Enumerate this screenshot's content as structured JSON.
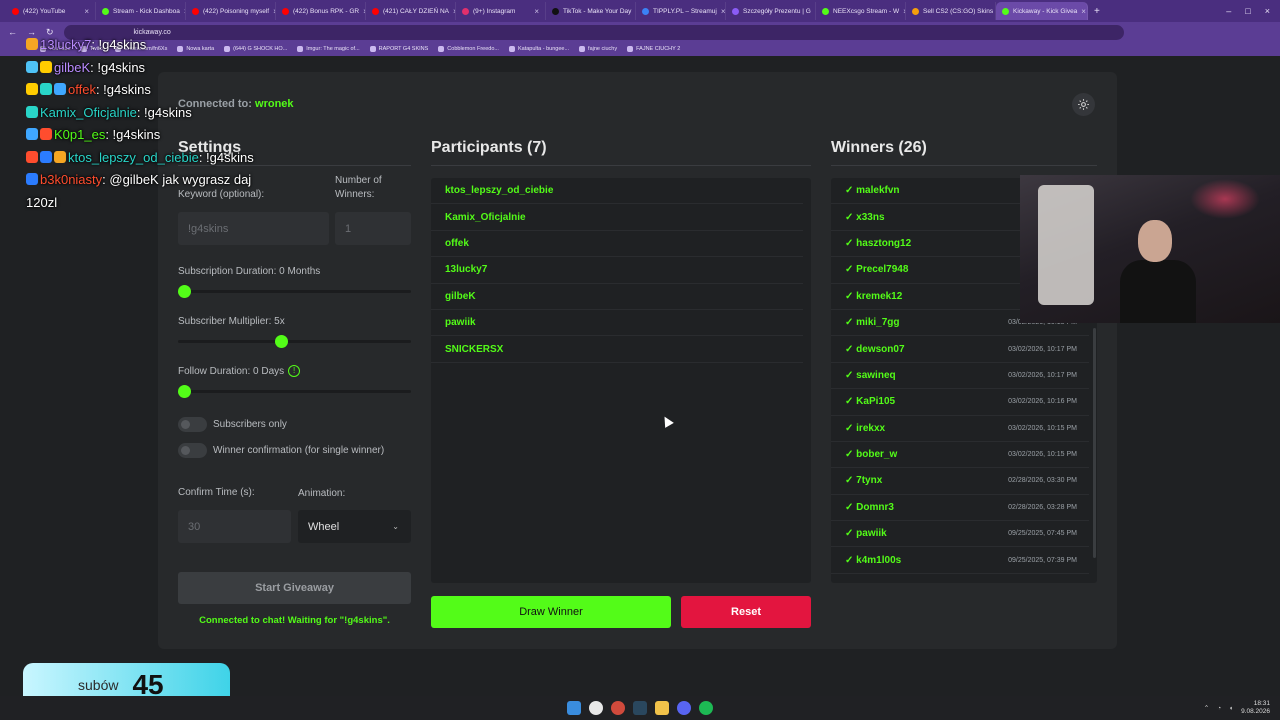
{
  "browser": {
    "tabs": [
      {
        "label": "(422) YouTube",
        "color": "#ff0000"
      },
      {
        "label": "Stream - Kick Dashboa",
        "color": "#53fc18"
      },
      {
        "label": "(422) Poisoning myself",
        "color": "#ff0000"
      },
      {
        "label": "(422) Bonus RPK - GR",
        "color": "#ff0000"
      },
      {
        "label": "(421) CAŁY DZIEŃ NA",
        "color": "#ff0000"
      },
      {
        "label": "(9+) Instagram",
        "color": "#e1306c"
      },
      {
        "label": "TikTok - Make Your Day",
        "color": "#111111"
      },
      {
        "label": "TIPPLY.PL – Streamuj",
        "color": "#3b82f6"
      },
      {
        "label": "Szczegóły Prezentu | G",
        "color": "#8b5cf6"
      },
      {
        "label": "NEEXcsgo Stream - W",
        "color": "#53fc18"
      },
      {
        "label": "Sell CS2 (CS:GO) Skins",
        "color": "#f59e0b"
      },
      {
        "label": "Kickaway - Kick Givea",
        "color": "#53fc18",
        "active": true
      }
    ],
    "url": "kickaway.co",
    "bookmarks": [
      "YouTube",
      "Twitch",
      "Enaza.com/fn6Xs",
      "Nowa karta",
      "(644) G SHOCK HO...",
      "Imgur: The magic of...",
      "RAPORT G4 SKINS",
      "Cobblemon Freedo...",
      "Katapulta - bungee...",
      "fajne ciuchy",
      "FAJNE CIUCHY 2"
    ]
  },
  "header": {
    "connected_prefix": "Connected to:",
    "channel": "wronek"
  },
  "settings": {
    "title": "Settings",
    "keyword_label": "Keyword (optional):",
    "keyword_placeholder": "!g4skins",
    "winners_label": "Number of Winners:",
    "winners_placeholder": "1",
    "subscription_duration_label": "Subscription Duration: 0 Months",
    "subscription_duration_value": 0,
    "subscriber_multiplier_label": "Subscriber Multiplier: 5x",
    "subscriber_multiplier_value": 0.5,
    "follow_duration_label": "Follow Duration: 0  Days",
    "follow_duration_value": 0,
    "subscribers_only_label": "Subscribers only",
    "winner_confirmation_label": "Winner confirmation (for single winner)",
    "confirm_time_label": "Confirm Time (s):",
    "confirm_time_placeholder": "30",
    "animation_label": "Animation:",
    "animation_value": "Wheel",
    "start_button": "Start Giveaway",
    "status": "Connected to chat! Waiting for \"!g4skins\"."
  },
  "participants": {
    "title": "Participants (7)",
    "items": [
      "ktos_lepszy_od_ciebie",
      "Kamix_Oficjalnie",
      "offek",
      "13lucky7",
      "gilbeK",
      "pawiik",
      "SNICKERSX"
    ]
  },
  "winners": {
    "title": "Winners (26)",
    "items": [
      {
        "name": "✓ malekfvn",
        "date": "03/0"
      },
      {
        "name": "✓ x33ns",
        "date": "03/0"
      },
      {
        "name": "✓ hasztong12",
        "date": "03/0"
      },
      {
        "name": "✓ Precel7948",
        "date": "03/0"
      },
      {
        "name": "✓ kremek12",
        "date": "03/0"
      },
      {
        "name": "✓ miki_7gg",
        "date": "03/02/2026, 10:18 PM"
      },
      {
        "name": "✓ dewson07",
        "date": "03/02/2026, 10:17 PM"
      },
      {
        "name": "✓ sawineq",
        "date": "03/02/2026, 10:17 PM"
      },
      {
        "name": "✓ KaPi105",
        "date": "03/02/2026, 10:16 PM"
      },
      {
        "name": "✓ irekxx",
        "date": "03/02/2026, 10:15 PM"
      },
      {
        "name": "✓ bober_w",
        "date": "03/02/2026, 10:15 PM"
      },
      {
        "name": "✓ 7tynx",
        "date": "02/28/2026, 03:30 PM"
      },
      {
        "name": "✓ Domnr3",
        "date": "02/28/2026, 03:28 PM"
      },
      {
        "name": "✓ pawiik",
        "date": "09/25/2025, 07:45 PM"
      },
      {
        "name": "✓ k4m1l00s",
        "date": "09/25/2025, 07:39 PM"
      }
    ]
  },
  "actions": {
    "draw": "Draw Winner",
    "reset": "Reset"
  },
  "chat": {
    "lines": [
      {
        "user": "13lucky7",
        "msg": ": !g4skins",
        "cls": "u-purple"
      },
      {
        "user": "gilbeK",
        "msg": ": !g4skins",
        "cls": "u-purple"
      },
      {
        "user": "offek",
        "msg": ": !g4skins",
        "cls": "u-orange"
      },
      {
        "user": "Kamix_Oficjalnie",
        "msg": ": !g4skins",
        "cls": "u-cyan"
      },
      {
        "user": "K0p1_es",
        "msg": ": !g4skins",
        "cls": "u-green"
      },
      {
        "user": "ktos_lepszy_od_ciebie",
        "msg": ": !g4skins",
        "cls": "u-cyan"
      },
      {
        "user": "b3k0niasty",
        "msg": ": @gilbeK jak wygrasz daj",
        "cls": "u-orange"
      },
      {
        "user": "",
        "msg": "120zl",
        "cls": ""
      }
    ]
  },
  "overlay": {
    "sub_label": "subów",
    "sub_count": "45"
  },
  "taskbar": {
    "time": "18:31",
    "date": "9.08.2026"
  },
  "colors": {
    "accent": "#53fc18",
    "danger": "#e3153f",
    "card": "#27292b"
  }
}
